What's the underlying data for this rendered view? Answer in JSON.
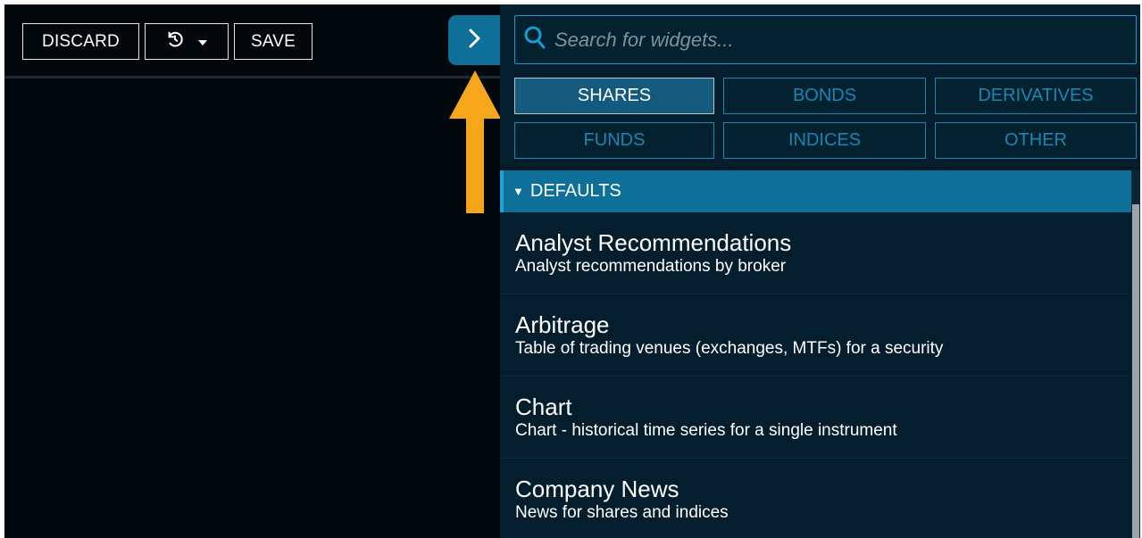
{
  "toolbar": {
    "discard_label": "DISCARD",
    "save_label": "SAVE",
    "history_icon": "history-icon",
    "dropdown_icon": "caret-down-icon"
  },
  "panel_toggle": {
    "icon": "chevron-right-icon"
  },
  "search": {
    "placeholder": "Search for widgets...",
    "value": ""
  },
  "filters": [
    {
      "label": "SHARES",
      "active": true
    },
    {
      "label": "BONDS",
      "active": false
    },
    {
      "label": "DERIVATIVES",
      "active": false
    },
    {
      "label": "FUNDS",
      "active": false
    },
    {
      "label": "INDICES",
      "active": false
    },
    {
      "label": "OTHER",
      "active": false
    }
  ],
  "section": {
    "label": "DEFAULTS",
    "expanded": true
  },
  "widgets": [
    {
      "title": "Analyst Recommendations",
      "description": "Analyst recommendations by broker"
    },
    {
      "title": "Arbitrage",
      "description": "Table of trading venues (exchanges, MTFs) for a security"
    },
    {
      "title": "Chart",
      "description": "Chart - historical time series for a single instrument"
    },
    {
      "title": "Company News",
      "description": "News for shares and indices"
    }
  ],
  "colors": {
    "background": "#02080c",
    "panel": "#041e2d",
    "accent": "#0e6f99",
    "filter_border": "#1a86b8",
    "annotation_arrow": "#f5a61a"
  }
}
